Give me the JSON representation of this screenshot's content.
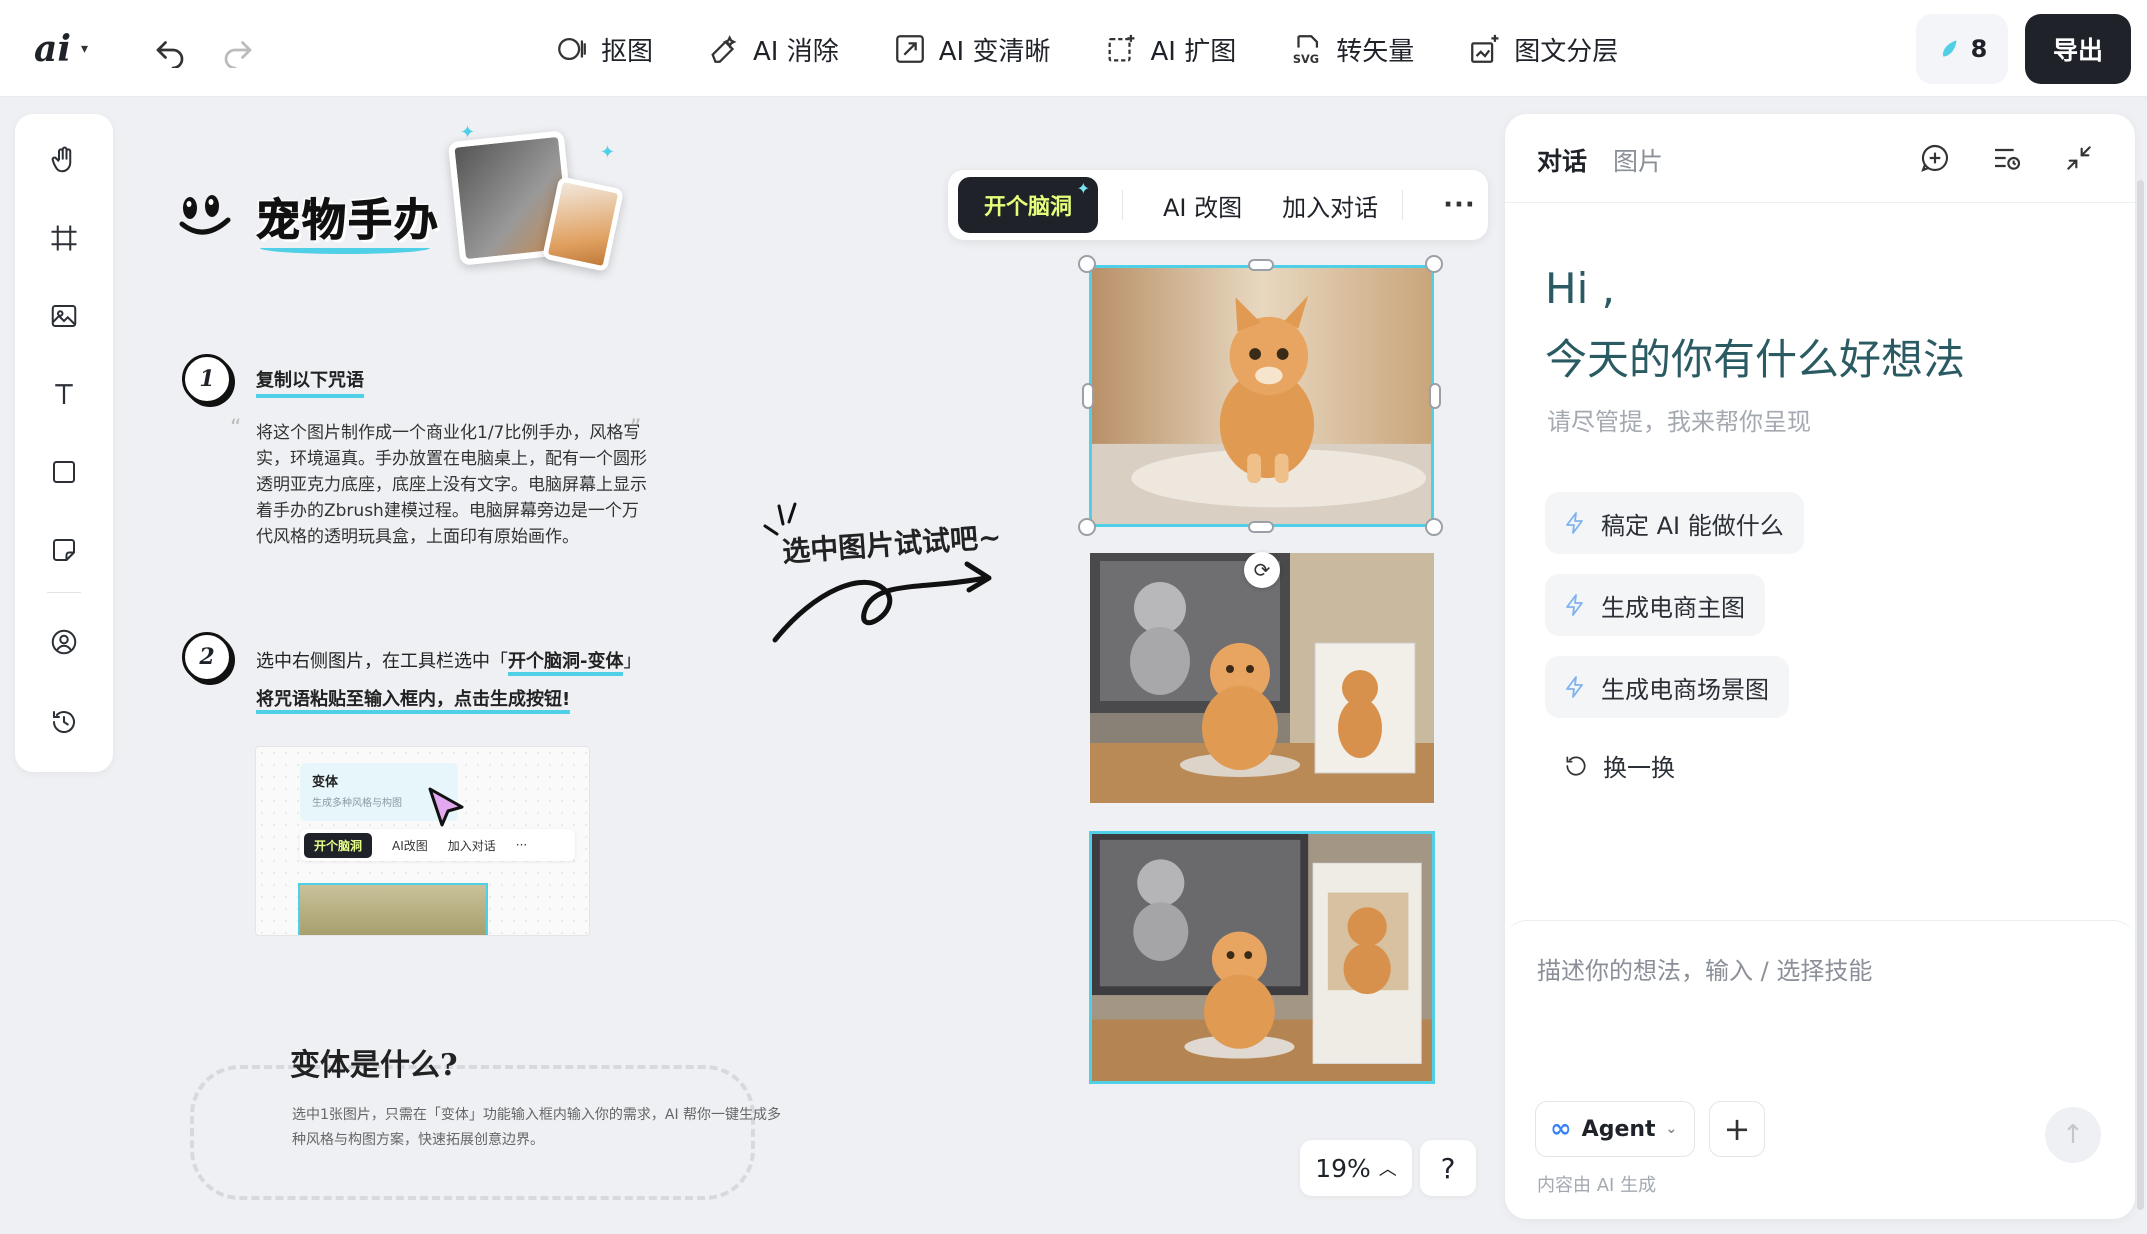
{
  "toolbar": {
    "logo": "ai",
    "tools": [
      {
        "label": "抠图",
        "icon": "cutout-icon"
      },
      {
        "label": "AI 消除",
        "icon": "eraser-icon"
      },
      {
        "label": "AI 变清晰",
        "icon": "enhance-icon"
      },
      {
        "label": "AI 扩图",
        "icon": "expand-icon"
      },
      {
        "label": "转矢量",
        "icon": "svg-icon"
      },
      {
        "label": "图文分层",
        "icon": "layers-icon"
      }
    ],
    "credits": "8",
    "export_label": "导出"
  },
  "doc": {
    "title": "宠物手办",
    "step1_num": "1",
    "step1_title": "复制以下咒语",
    "step1_prompt": "将这个图片制作成一个商业化1/7比例手办，风格写实，环境逼真。手办放置在电脑桌上，配有一个圆形透明亚克力底座，底座上没有文字。电脑屏幕上显示着手办的Zbrush建模过程。电脑屏幕旁边是一个万代风格的透明玩具盒，上面印有原始画作。",
    "step2_num": "2",
    "step2_line1_prefix": "选中右侧图片，在工具栏选中「",
    "step2_line1_bold": "开个脑洞-变体",
    "step2_line1_suffix": "」",
    "step2_line2": "将咒语粘贴至输入框内，点击生成按钮!",
    "mini": {
      "card_title": "变体",
      "card_desc": "生成多种风格与构图",
      "brain": "开个脑洞",
      "ai_edit": "AI改图",
      "add_chat": "加入对话",
      "more": "···"
    },
    "what_title": "变体是什么?",
    "what_desc": "选中1张图片，只需在「变体」功能输入框内输入你的需求，AI 帮你一键生成多种风格与构图方案，快速拓展创意边界。",
    "try_it": "选中图片试试吧~"
  },
  "floatbar": {
    "brain_label": "开个脑洞",
    "ai_edit": "AI 改图",
    "add_chat": "加入对话",
    "more": "···"
  },
  "bottom": {
    "zoom": "19%",
    "help": "?"
  },
  "panel": {
    "tab_chat": "对话",
    "tab_image": "图片",
    "hi": "Hi ,",
    "greeting": "今天的你有什么好想法",
    "subtitle": "请尽管提，我来帮你呈现",
    "chips": [
      "稿定 AI 能做什么",
      "生成电商主图",
      "生成电商场景图"
    ],
    "refresh": "换一换",
    "placeholder": "描述你的想法，输入 / 选择技能",
    "agent": "Agent",
    "ai_note": "内容由 AI 生成"
  },
  "colors": {
    "accent": "#4fd0e6",
    "dark": "#1f2329",
    "brain_text": "#e6ff7a"
  }
}
